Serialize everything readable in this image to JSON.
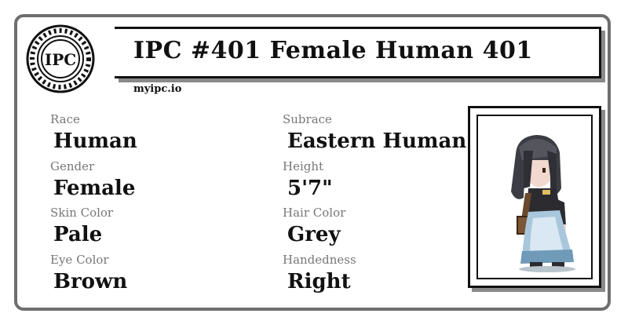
{
  "header": {
    "logo_text": "IPC",
    "title": "IPC #401 Female Human 401",
    "site": "myipc.io"
  },
  "attributes": [
    {
      "label": "Race",
      "value": "Human"
    },
    {
      "label": "Subrace",
      "value": "Eastern Human"
    },
    {
      "label": "Gender",
      "value": "Female"
    },
    {
      "label": "Height",
      "value": "5'7\""
    },
    {
      "label": "Skin Color",
      "value": "Pale"
    },
    {
      "label": "Hair Color",
      "value": "Grey"
    },
    {
      "label": "Eye Color",
      "value": "Brown"
    },
    {
      "label": "Handedness",
      "value": "Right"
    }
  ],
  "colors": {
    "border": "#6e6e6e",
    "label": "#777777",
    "text": "#111111"
  }
}
